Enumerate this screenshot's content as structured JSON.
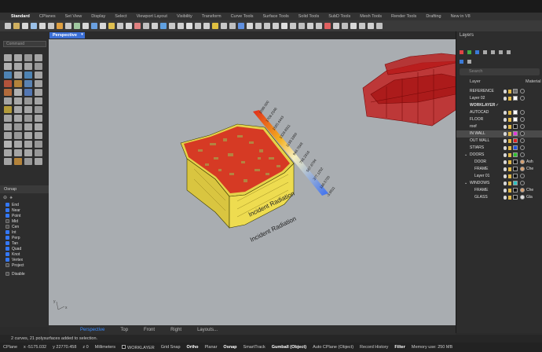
{
  "menu_tabs": [
    "Standard",
    "CPlanes",
    "Set View",
    "Display",
    "Select",
    "Viewport Layout",
    "Visibility",
    "Transform",
    "Curve Tools",
    "Surface Tools",
    "Solid Tools",
    "SubD Tools",
    "Mesh Tools",
    "Render Tools",
    "Drafting",
    "New in V8"
  ],
  "command": {
    "placeholder": "Command"
  },
  "osnap": {
    "title": "Osnap",
    "items": [
      {
        "label": "End",
        "checked": true
      },
      {
        "label": "Near",
        "checked": true
      },
      {
        "label": "Point",
        "checked": true
      },
      {
        "label": "Mid",
        "checked": false
      },
      {
        "label": "Cen",
        "checked": false
      },
      {
        "label": "Int",
        "checked": true
      },
      {
        "label": "Perp",
        "checked": true
      },
      {
        "label": "Tan",
        "checked": true
      },
      {
        "label": "Quad",
        "checked": true
      },
      {
        "label": "Knot",
        "checked": true
      },
      {
        "label": "Vertex",
        "checked": true
      },
      {
        "label": "Project",
        "checked": false
      }
    ],
    "disable_label": "Disable"
  },
  "viewport": {
    "title": "Perspective",
    "bottom_tabs": [
      "Perspective",
      "Top",
      "Front",
      "Right",
      "Layouts..."
    ],
    "legend_values": [
      "1899.000",
      "1708.2346",
      "1520.4443",
      "1329.8911",
      "1139.3380",
      "948.7848",
      "758.2316",
      "567.6784",
      "377.1252",
      "186.5720",
      "-3.9811"
    ],
    "labels": [
      "Incident Radiation",
      "Incident Radiation"
    ]
  },
  "layers": {
    "title": "Layers",
    "search_placeholder": "Search",
    "col_layer": "Layer",
    "col_material": "Material",
    "rows": [
      {
        "name": "REFERENCE",
        "indent": 0,
        "color": "#6e6e6e",
        "mat": ""
      },
      {
        "name": "Layer 02",
        "indent": 0,
        "color": "#ffffff",
        "mat": ""
      },
      {
        "name": "WORKLAYER",
        "indent": 0,
        "color": "",
        "mat": "",
        "current": true
      },
      {
        "name": "AUTOCAD",
        "indent": 0,
        "color": "#ffffff",
        "mat": ""
      },
      {
        "name": "FLOOR",
        "indent": 0,
        "color": "#ffffff",
        "mat": ""
      },
      {
        "name": "roof",
        "indent": 0,
        "color": "#111111",
        "mat": ""
      },
      {
        "name": "IN WALL",
        "indent": 0,
        "color": "#e03ad8",
        "mat": "",
        "selected": true
      },
      {
        "name": "OUT WALL",
        "indent": 0,
        "color": "#e02020",
        "mat": ""
      },
      {
        "name": "STIARS",
        "indent": 0,
        "color": "#2050e0",
        "mat": ""
      },
      {
        "name": "DOORS",
        "indent": 0,
        "color": "#30c030",
        "mat": "",
        "group": true
      },
      {
        "name": "DOOR",
        "indent": 1,
        "color": "#111111",
        "mat": "Ash",
        "matcolor": "#d8a070"
      },
      {
        "name": "FRAME",
        "indent": 1,
        "color": "#111111",
        "mat": "Che",
        "matcolor": "#d8a070"
      },
      {
        "name": "Layer 01",
        "indent": 1,
        "color": "#111111",
        "mat": ""
      },
      {
        "name": "WINDOWS",
        "indent": 0,
        "color": "#30c0c0",
        "mat": "",
        "group": true
      },
      {
        "name": "FRAME",
        "indent": 1,
        "color": "#111111",
        "mat": "Che",
        "matcolor": "#d8a070"
      },
      {
        "name": "GLASS",
        "indent": 1,
        "color": "#111111",
        "mat": "Gla",
        "matcolor": "#e0e0e0"
      }
    ]
  },
  "command_history": "2 curves, 21 polysurfaces added to selection.",
  "status": {
    "cplane": "CPlane",
    "x": "x -5175.032",
    "y": "y 22770.458",
    "z": "z 0",
    "units": "Millimeters",
    "layer": "WORKLAYER",
    "grid_snap": "Grid Snap",
    "ortho": "Ortho",
    "planar": "Planar",
    "osnap": "Osnap",
    "smarttrack": "SmartTrack",
    "gumball": "Gumball (Object)",
    "auto_cplane": "Auto CPlane (Object)",
    "record_history": "Record History",
    "filter": "Filter",
    "memory": "Memory use: 250 MB"
  }
}
